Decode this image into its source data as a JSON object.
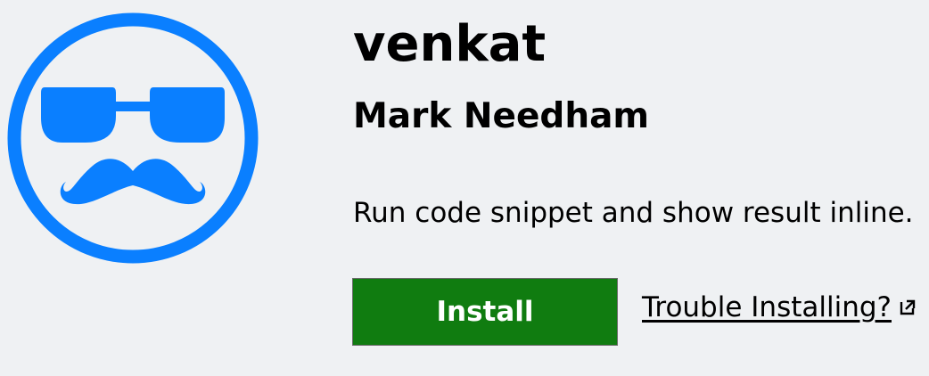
{
  "extension": {
    "name": "venkat",
    "publisher": "Mark Needham",
    "description": "Run code snippet and show result inline."
  },
  "actions": {
    "install_label": "Install",
    "trouble_label": "Trouble Installing?"
  },
  "icons": {
    "logo": "sunglasses-mustache-face-icon",
    "external_link": "external-link-icon"
  },
  "colors": {
    "background": "#eff1f3",
    "logo_blue": "#0a7fff",
    "install_green": "#107c10",
    "text": "#000000"
  }
}
